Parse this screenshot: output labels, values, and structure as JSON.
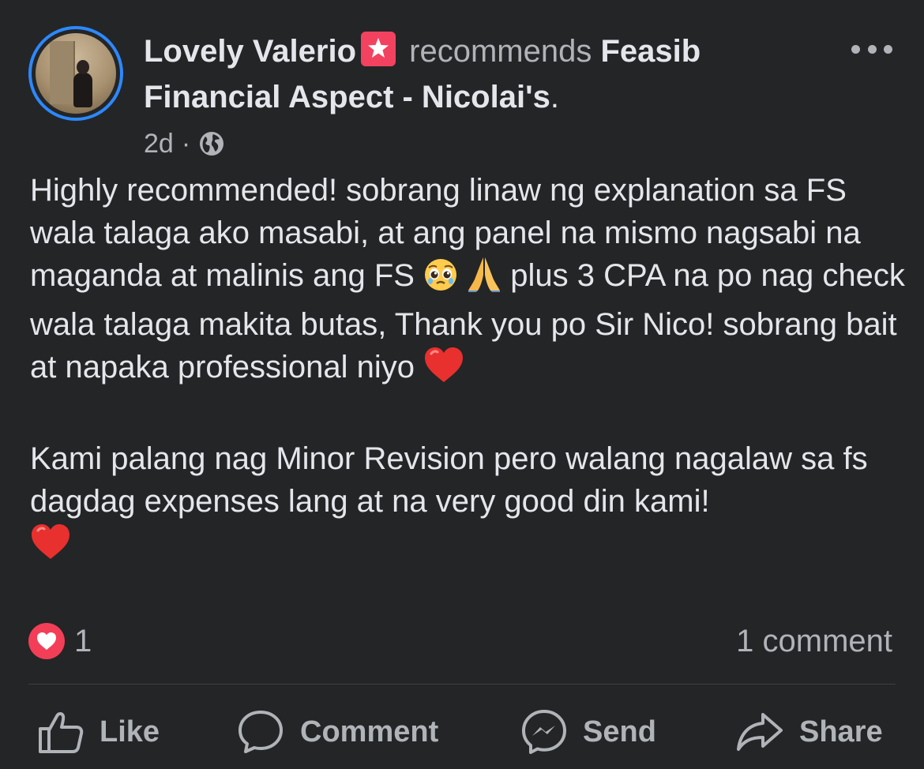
{
  "post": {
    "author": "Lovely Valerio",
    "recommends_text": "recommends",
    "page_name_line1": "Feasib",
    "page_name_line2": "Financial Aspect - Nicolai's",
    "page_name_suffix": ".",
    "time": "2d",
    "time_separator": "·",
    "privacy_icon": "globe-icon",
    "body_paragraph1_part1": "Highly recommended! sobrang linaw ng explanation sa FS wala talaga ako masabi, at ang panel na mismo nagsabi na maganda at malinis ang FS ",
    "emoji_1": "pleading-face",
    "emoji_2": "folded-hands",
    "body_paragraph1_part2": " plus 3 CPA na po nag check wala talaga makita butas, Thank you po Sir Nico! sobrang bait at napaka professional niyo ",
    "emoji_3": "red-heart",
    "body_paragraph2": "Kami palang nag Minor Revision pero walang nagalaw sa fs dagdag expenses lang at na very good din kami!",
    "emoji_4": "red-heart"
  },
  "reactions": {
    "icon": "love-reaction-icon",
    "count": "1",
    "comments": "1 comment"
  },
  "actions": {
    "like": "Like",
    "comment": "Comment",
    "send": "Send",
    "share": "Share"
  },
  "colors": {
    "background": "#242526",
    "text_primary": "#e4e6eb",
    "text_secondary": "#b0b3b8",
    "avatar_ring": "#2d88ff",
    "recommend_badge": "#f3425f",
    "love_reaction": "#f33e58"
  }
}
